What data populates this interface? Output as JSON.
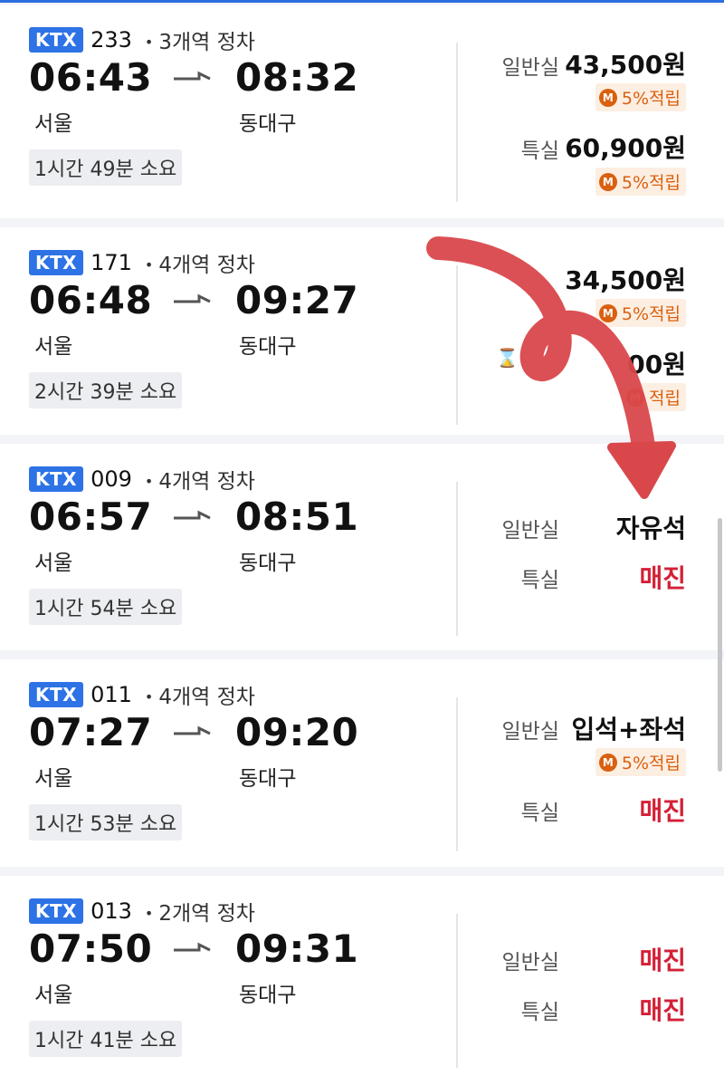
{
  "ui": {
    "accent": "#2d73e6",
    "soldout_color": "#d32036",
    "point_color": "#d9600e"
  },
  "trains": [
    {
      "type": "KTX",
      "number": "233",
      "stops": "3개역 정차",
      "dep_time": "06:43",
      "arr_time": "08:32",
      "dep_station": "서울",
      "arr_station": "동대구",
      "duration": "1시간 49분 소요",
      "general_label": "일반실",
      "general_value": "43,500원",
      "general_point": "5%적립",
      "special_label": "특실",
      "special_value": "60,900원",
      "special_point": "5%적립"
    },
    {
      "type": "KTX",
      "number": "171",
      "stops": "4개역 정차",
      "dep_time": "06:48",
      "arr_time": "09:27",
      "dep_station": "서울",
      "arr_station": "동대구",
      "duration": "2시간 39분 소요",
      "general_value": "34,500원",
      "general_point": "5%적립",
      "special_value": "00원",
      "special_point": "적립"
    },
    {
      "type": "KTX",
      "number": "009",
      "stops": "4개역 정차",
      "dep_time": "06:57",
      "arr_time": "08:51",
      "dep_station": "서울",
      "arr_station": "동대구",
      "duration": "1시간 54분 소요",
      "general_label": "일반실",
      "general_value": "자유석",
      "special_label": "특실",
      "special_value": "매진"
    },
    {
      "type": "KTX",
      "number": "011",
      "stops": "4개역 정차",
      "dep_time": "07:27",
      "arr_time": "09:20",
      "dep_station": "서울",
      "arr_station": "동대구",
      "duration": "1시간 53분 소요",
      "general_label": "일반실",
      "general_value": "입석+좌석",
      "general_point": "5%적립",
      "special_label": "특실",
      "special_value": "매진"
    },
    {
      "type": "KTX",
      "number": "013",
      "stops": "2개역 정차",
      "dep_time": "07:50",
      "arr_time": "09:31",
      "dep_station": "서울",
      "arr_station": "동대구",
      "duration": "1시간 41분 소요",
      "general_label": "일반실",
      "general_value": "매진",
      "special_label": "특실",
      "special_value": "매진"
    }
  ],
  "icons": {
    "point_coin": "M",
    "arrow": "right-arrow-icon",
    "waiting": "hourglass-icon"
  }
}
